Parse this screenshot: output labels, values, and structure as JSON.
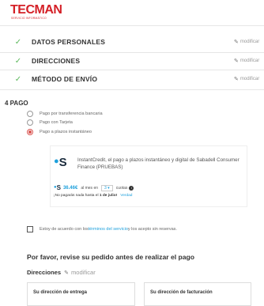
{
  "brand": {
    "name": "TECMAN",
    "tagline": "SERVICIO INFORMÁTICO"
  },
  "steps": [
    {
      "label": "DATOS PERSONALES",
      "edit": "modificar"
    },
    {
      "label": "DIRECCIONES",
      "edit": "modificar"
    },
    {
      "label": "MÉTODO DE ENVÍO",
      "edit": "modificar"
    }
  ],
  "payment": {
    "title": "4  PAGO",
    "options": [
      {
        "label": "Pago por transferencia bancaria",
        "selected": false
      },
      {
        "label": "Pago con Tarjeta",
        "selected": false
      },
      {
        "label": "Pago a plazos instantáneo",
        "selected": true
      }
    ]
  },
  "instantcredit": {
    "logo": "S",
    "description": "InstantCredit, el pago a plazos instantáneo y digital de Sabadell Consumer Finance (PRUEBAS)",
    "logo_small": "S",
    "amount": "36.46€",
    "per_month": "al mes en",
    "installments": "3",
    "installments_suffix": "cuotas",
    "note_prefix": "¡No pagarás nada hasta el ",
    "note_date": "1 de julio!",
    "note_link": "Verdad"
  },
  "terms": {
    "prefix": "Estoy de acuerdo con los ",
    "link": "términos del servicio",
    "suffix": " y los acepto sin reservas."
  },
  "review": {
    "title": "Por favor, revise su pedido antes de realizar el pago",
    "addresses_label": "Direcciones",
    "addresses_edit": "modificar",
    "delivery": "Su dirección de entrega",
    "billing": "Su dirección de facturación"
  },
  "colors": {
    "brand": "#d41f26",
    "check": "#5cb85c",
    "link": "#1ea0dc",
    "radio_selected": "#d9534f"
  },
  "icons": {
    "step_done": "check-icon",
    "edit": "pencil-icon",
    "info": "info-icon"
  }
}
